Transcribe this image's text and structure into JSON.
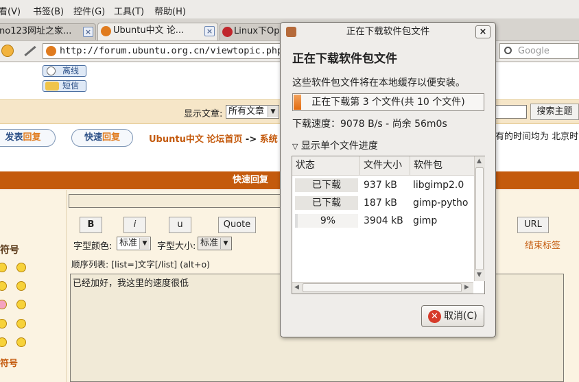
{
  "menubar": {
    "items": [
      "查看(V)",
      "书签(B)",
      "控件(G)",
      "工具(T)",
      "帮助(H)"
    ],
    "visible_first": "看(V)"
  },
  "tabs": [
    {
      "label": "no123网址之家...",
      "active": false
    },
    {
      "label": "Ubuntu中文 论...",
      "active": true
    },
    {
      "label": "Linux下Op",
      "active": false
    }
  ],
  "navbar": {
    "url": "http://forum.ubuntu.org.cn/viewtopic.php",
    "search_placeholder": "Google"
  },
  "page": {
    "offline_label": "离线",
    "message_label": "短信",
    "show_posts_label": "显示文章:",
    "show_posts_value": "所有文章",
    "search_topic_button": "搜索主题",
    "post_reply_button": "发表回复",
    "quick_reply_button": "快速回复",
    "breadcrumb_site": "Ubuntu中文",
    "breadcrumb_index": "论坛首页",
    "breadcrumb_arrow": "->",
    "breadcrumb_section": "系统",
    "timezone_note": "有的时间均为 北京时间",
    "quick_reply_header": "快速回复",
    "format_buttons": [
      "B",
      "i",
      "u",
      "Quote",
      "URL"
    ],
    "font_color_label": "字型颜色:",
    "font_color_value": "标准",
    "font_size_label": "字型大小:",
    "font_size_value": "标准",
    "close_tags_label": "结束标签",
    "list_hint": "顺序列表: [list=]文字[/list] (alt+o)",
    "textarea_value": "已经加好，我这里的速度很低",
    "left_label_1": "符号",
    "left_label_2": "符号"
  },
  "dialog": {
    "title": "正在下载软件包文件",
    "close_glyph": "×",
    "heading": "正在下载软件包文件",
    "description": "这些软件包文件将在本地缓存以便安装。",
    "progress_text": "正在下载第 3 个文件(共 10 个文件)",
    "progress_fraction": 0.04,
    "speed_text": "下载速度：9078  B/s - 尚余 56m0s",
    "expander_label": "显示单个文件进度",
    "columns": [
      "状态",
      "文件大小",
      "软件包"
    ],
    "rows": [
      {
        "status": "已下载",
        "size": "937 kB",
        "package": "libgimp2.0"
      },
      {
        "status": "已下载",
        "size": "187 kB",
        "package": "gimp-pytho"
      },
      {
        "status": "9%",
        "size": "3904 kB",
        "package": "gimp"
      }
    ],
    "cancel_label": "取消(C)"
  },
  "colors": {
    "accent_orange": "#c45a0d",
    "progress_orange": "#e26b10",
    "link_blue": "#2b4f86"
  }
}
